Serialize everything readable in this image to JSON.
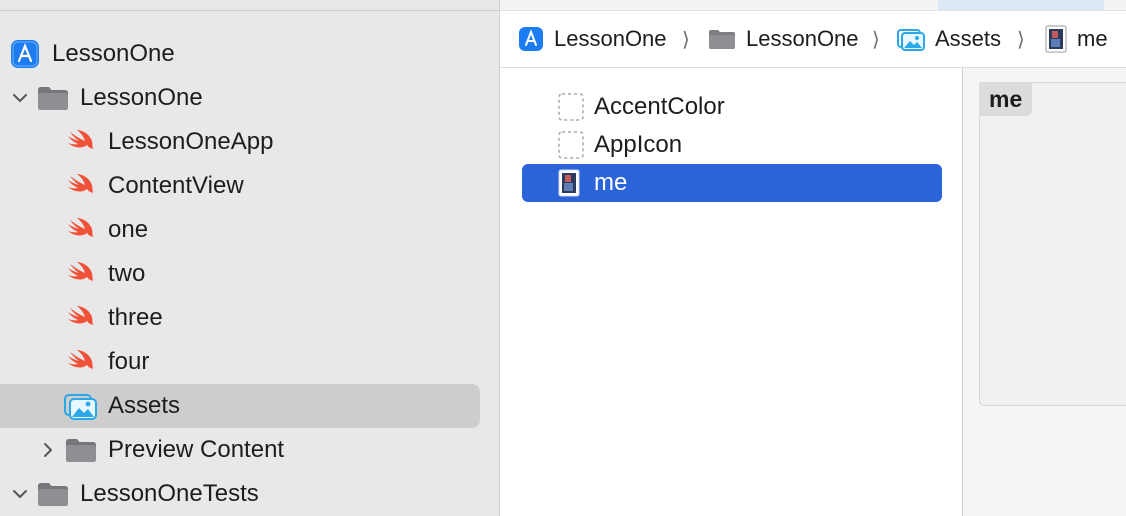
{
  "navigator": {
    "items": [
      {
        "label": "LessonOne",
        "icon": "xcode-project-icon",
        "indent": 0,
        "disclosure": "none"
      },
      {
        "label": "LessonOne",
        "icon": "folder-icon",
        "indent": 0,
        "disclosure": "expanded"
      },
      {
        "label": "LessonOneApp",
        "icon": "swift-file-icon",
        "indent": 1,
        "disclosure": "none"
      },
      {
        "label": "ContentView",
        "icon": "swift-file-icon",
        "indent": 1,
        "disclosure": "none"
      },
      {
        "label": "one",
        "icon": "swift-file-icon",
        "indent": 1,
        "disclosure": "none"
      },
      {
        "label": "two",
        "icon": "swift-file-icon",
        "indent": 1,
        "disclosure": "none"
      },
      {
        "label": "three",
        "icon": "swift-file-icon",
        "indent": 1,
        "disclosure": "none"
      },
      {
        "label": "four",
        "icon": "swift-file-icon",
        "indent": 1,
        "disclosure": "none"
      },
      {
        "label": "Assets",
        "icon": "asset-catalog-icon",
        "indent": 1,
        "disclosure": "none",
        "selected": true
      },
      {
        "label": "Preview Content",
        "icon": "folder-icon",
        "indent": 1,
        "disclosure": "collapsed"
      },
      {
        "label": "LessonOneTests",
        "icon": "folder-icon",
        "indent": 0,
        "disclosure": "expanded"
      }
    ]
  },
  "breadcrumb": {
    "items": [
      {
        "label": "LessonOne",
        "icon": "xcode-project-icon"
      },
      {
        "label": "LessonOne",
        "icon": "folder-icon"
      },
      {
        "label": "Assets",
        "icon": "asset-catalog-icon"
      },
      {
        "label": "me",
        "icon": "image-thumbnail-icon"
      }
    ],
    "separator": "⟩"
  },
  "assets": {
    "items": [
      {
        "label": "AccentColor",
        "icon": "empty-slot-icon"
      },
      {
        "label": "AppIcon",
        "icon": "empty-slot-icon"
      },
      {
        "label": "me",
        "icon": "image-thumbnail-icon",
        "selected": true
      }
    ]
  },
  "detail": {
    "title": "me"
  },
  "colors": {
    "selection_blue": "#2b63d9",
    "swift_orange": "#f05138",
    "xcode_blue": "#1e7cf2",
    "folder_gray": "#7d7d82",
    "asset_cyan": "#2aa8e8"
  }
}
